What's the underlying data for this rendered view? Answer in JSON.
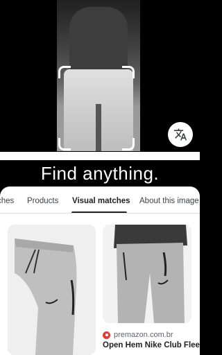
{
  "viewfinder": {
    "translate_icon": "translate-icon"
  },
  "tagline": "Find anything.",
  "tabs": [
    {
      "label": "ches",
      "active": false
    },
    {
      "label": "Products",
      "active": false
    },
    {
      "label": "Visual matches",
      "active": true
    },
    {
      "label": "About this image",
      "active": false
    }
  ],
  "results": [
    {
      "image": "grey-jogger-pants-product-photo"
    },
    {
      "image": "grey-jogger-pants-model-photo",
      "source": "premazon.com.br",
      "title": "Open Hem Nike Club Fleece Pant Dark Gre"
    }
  ],
  "colors": {
    "accent": "#202124",
    "background": "#000000",
    "sheet": "#ffffff",
    "source_favicon": "#e53935"
  }
}
